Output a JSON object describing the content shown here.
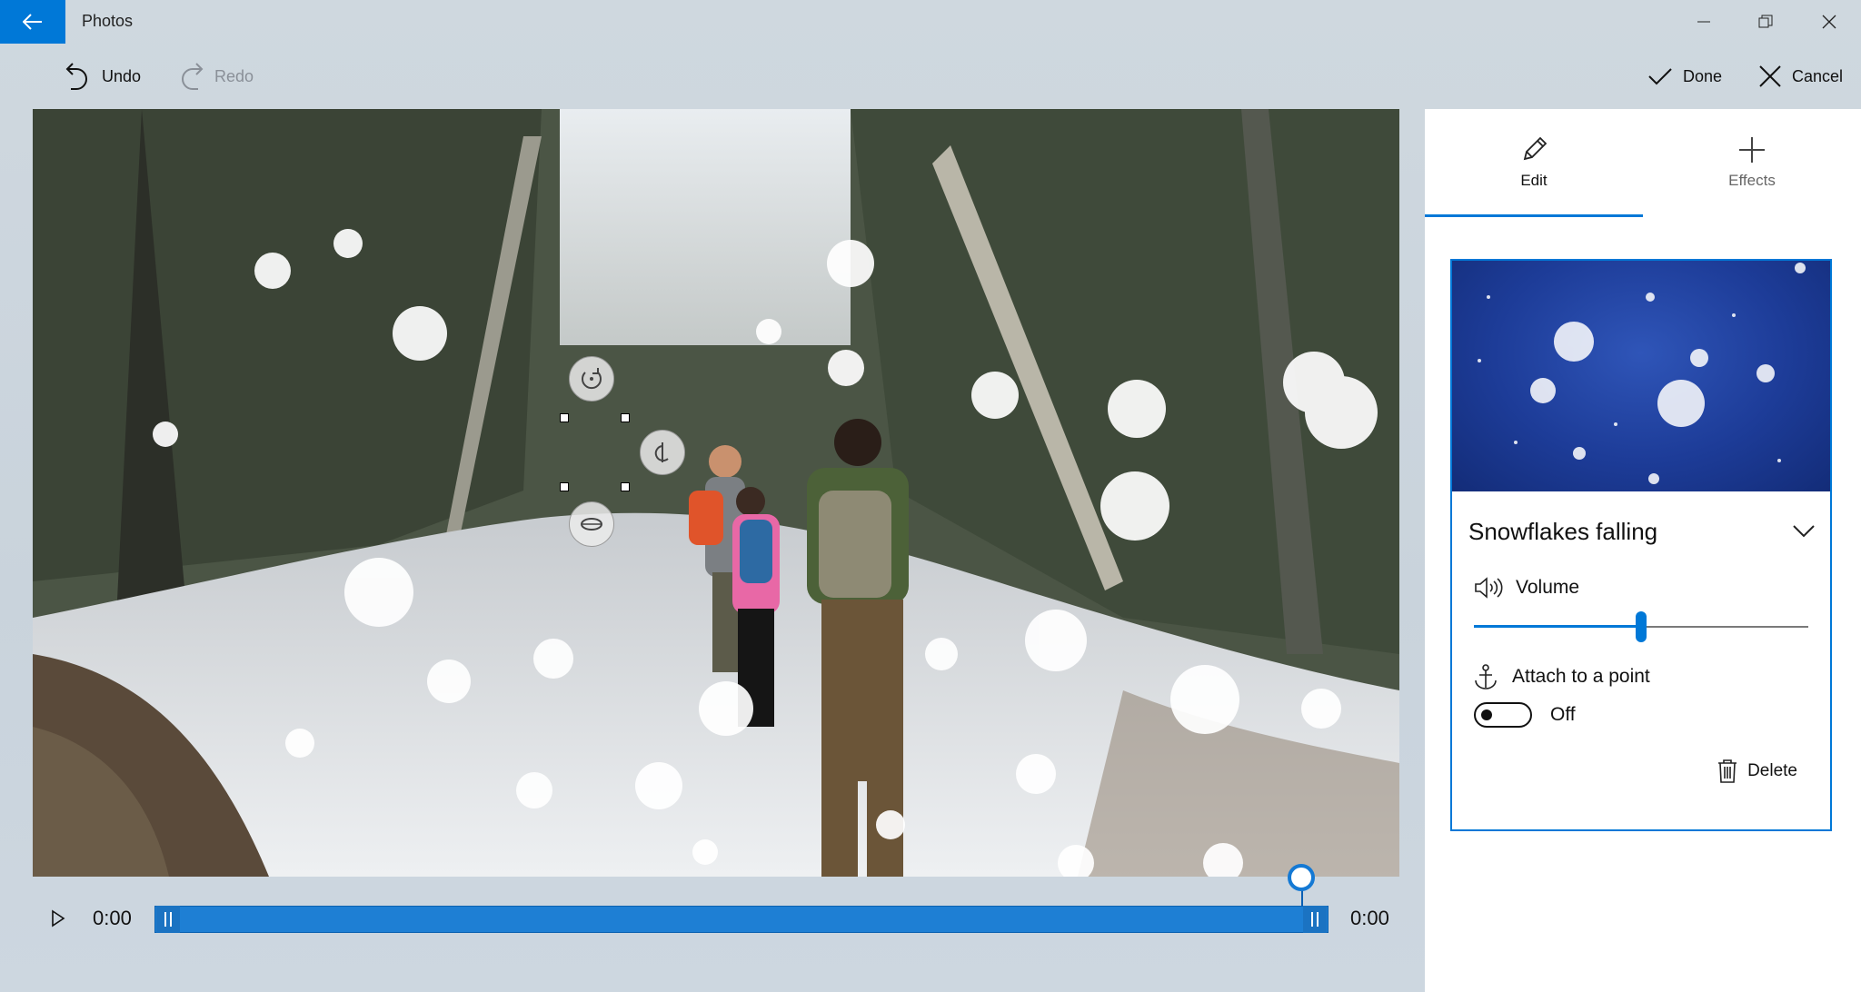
{
  "app": {
    "title": "Photos"
  },
  "toolbar": {
    "undo_label": "Undo",
    "redo_label": "Redo",
    "done_label": "Done",
    "cancel_label": "Cancel"
  },
  "timeline": {
    "start_time": "0:00",
    "end_time": "0:00",
    "playhead_fraction": 0.97
  },
  "tabs": [
    {
      "label": "Edit",
      "icon": "pencil-icon",
      "selected": true
    },
    {
      "label": "Effects",
      "icon": "plus-icon",
      "selected": false
    }
  ],
  "effect": {
    "name": "Snowflakes falling",
    "volume_label": "Volume",
    "volume_fraction": 0.5,
    "attach_label": "Attach to a point",
    "attach_state": "Off",
    "delete_label": "Delete"
  },
  "colors": {
    "accent": "#0078d7"
  }
}
